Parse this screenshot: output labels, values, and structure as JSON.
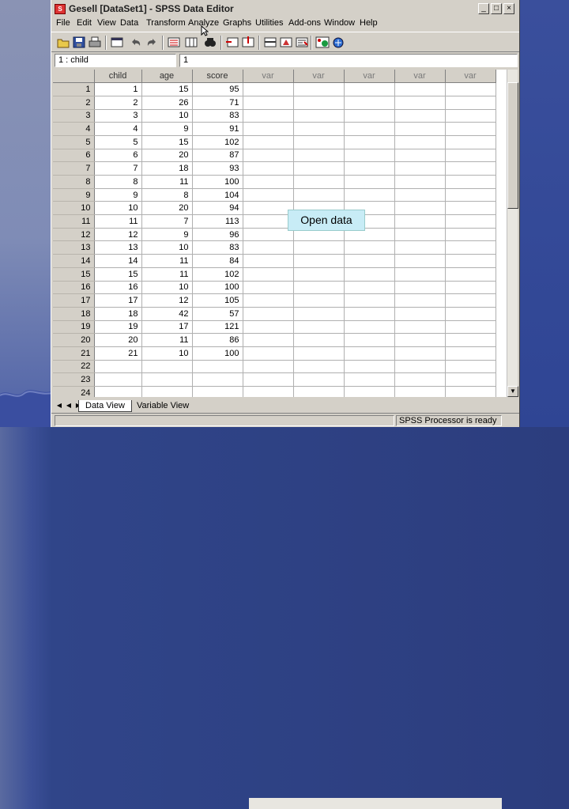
{
  "window": {
    "title": "Gesell [DataSet1] - SPSS Data Editor",
    "app_icon": "spss-icon",
    "controls": [
      "minimize-icon",
      "maximize-icon",
      "close-icon"
    ]
  },
  "menu": [
    "File",
    "Edit",
    "View",
    "Data",
    "Transform",
    "Analyze",
    "Graphs",
    "Utilities",
    "Add-ons",
    "Window",
    "Help"
  ],
  "toolbar": {
    "icons": [
      "open-icon",
      "save-icon",
      "print-icon",
      "dialog-recall-icon",
      "undo-icon",
      "redo-icon",
      "goto-case-icon",
      "variables-icon",
      "find-icon",
      "insert-cases-icon",
      "insert-variable-icon",
      "split-file-icon",
      "weight-cases-icon",
      "select-cases-icon",
      "value-labels-icon",
      "use-sets-icon"
    ]
  },
  "cell_editor": {
    "name_prefix": "1 :",
    "name": "child",
    "value": "1"
  },
  "grid": {
    "columns": [
      "child",
      "age",
      "score",
      "var",
      "var",
      "var",
      "var",
      "var"
    ],
    "rows": [
      {
        "n": "1",
        "child": "1",
        "age": "15",
        "score": "95"
      },
      {
        "n": "2",
        "child": "2",
        "age": "26",
        "score": "71"
      },
      {
        "n": "3",
        "child": "3",
        "age": "10",
        "score": "83"
      },
      {
        "n": "4",
        "child": "4",
        "age": "9",
        "score": "91"
      },
      {
        "n": "5",
        "child": "5",
        "age": "15",
        "score": "102"
      },
      {
        "n": "6",
        "child": "6",
        "age": "20",
        "score": "87"
      },
      {
        "n": "7",
        "child": "7",
        "age": "18",
        "score": "93"
      },
      {
        "n": "8",
        "child": "8",
        "age": "11",
        "score": "100"
      },
      {
        "n": "9",
        "child": "9",
        "age": "8",
        "score": "104"
      },
      {
        "n": "10",
        "child": "10",
        "age": "20",
        "score": "94"
      },
      {
        "n": "11",
        "child": "11",
        "age": "7",
        "score": "113"
      },
      {
        "n": "12",
        "child": "12",
        "age": "9",
        "score": "96"
      },
      {
        "n": "13",
        "child": "13",
        "age": "10",
        "score": "83"
      },
      {
        "n": "14",
        "child": "14",
        "age": "11",
        "score": "84"
      },
      {
        "n": "15",
        "child": "15",
        "age": "11",
        "score": "102"
      },
      {
        "n": "16",
        "child": "16",
        "age": "10",
        "score": "100"
      },
      {
        "n": "17",
        "child": "17",
        "age": "12",
        "score": "105"
      },
      {
        "n": "18",
        "child": "18",
        "age": "42",
        "score": "57"
      },
      {
        "n": "19",
        "child": "19",
        "age": "17",
        "score": "121"
      },
      {
        "n": "20",
        "child": "20",
        "age": "11",
        "score": "86"
      },
      {
        "n": "21",
        "child": "21",
        "age": "10",
        "score": "100"
      },
      {
        "n": "22",
        "child": "",
        "age": "",
        "score": ""
      },
      {
        "n": "23",
        "child": "",
        "age": "",
        "score": ""
      },
      {
        "n": "24",
        "child": "",
        "age": "",
        "score": ""
      }
    ]
  },
  "tabs": [
    {
      "label": "Data View",
      "active": true
    },
    {
      "label": "Variable View",
      "active": false
    }
  ],
  "status": {
    "processor": "SPSS Processor is ready"
  },
  "callout": {
    "text": "Open data"
  }
}
